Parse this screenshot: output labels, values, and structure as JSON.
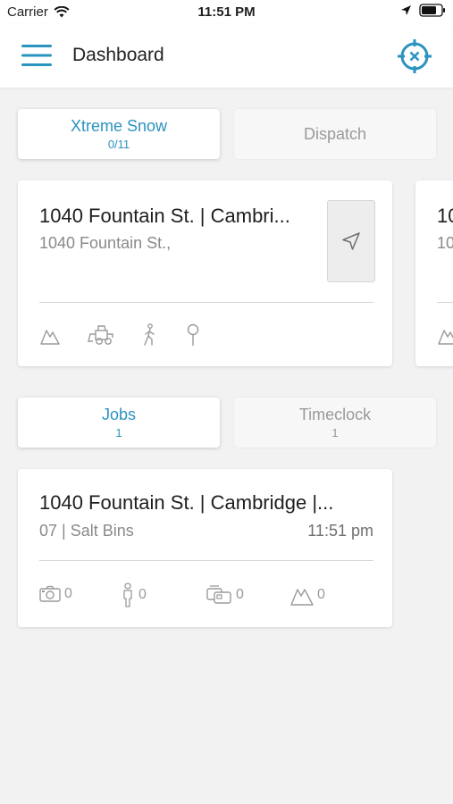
{
  "status_bar": {
    "carrier": "Carrier",
    "time": "11:51 PM"
  },
  "header": {
    "title": "Dashboard"
  },
  "company_tabs": [
    {
      "label": "Xtreme Snow",
      "count": "0/11"
    },
    {
      "label": "Dispatch"
    }
  ],
  "site_cards": [
    {
      "title": "1040 Fountain St. |  Cambri...",
      "address": "1040 Fountain St.,"
    },
    {
      "title": "10",
      "address": "10"
    }
  ],
  "work_tabs": [
    {
      "label": "Jobs",
      "count": "1"
    },
    {
      "label": "Timeclock",
      "count": "1"
    }
  ],
  "job_card": {
    "title": "1040 Fountain St. |  Cambridge |...",
    "service": "07 | Salt Bins",
    "time": "11:51 pm",
    "stats": {
      "photos": "0",
      "crew": "0",
      "equipment": "0",
      "snow": "0"
    }
  },
  "colors": {
    "accent": "#2b93bf",
    "muted": "#9a9a9a",
    "background": "#f2f2f3"
  },
  "icons": [
    "wifi-icon",
    "location-arrow-icon",
    "battery-icon",
    "menu-icon",
    "crosshair-icon",
    "navigate-icon",
    "mountain-icon",
    "loader-truck-icon",
    "walking-person-icon",
    "pin-icon",
    "camera-icon",
    "person-icon"
  ]
}
